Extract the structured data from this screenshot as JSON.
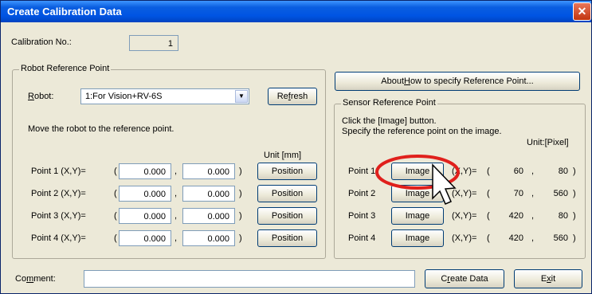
{
  "window": {
    "title": "Create Calibration Data",
    "close_glyph": "✕"
  },
  "calibration": {
    "label": "Calibration No.:",
    "value": "1"
  },
  "robot_group": {
    "title": "Robot Reference Point",
    "robot_label_u": "R",
    "robot_label_rest": "obot:",
    "robot_value": "1:For Vision+RV-6S",
    "refresh_pre": "Re",
    "refresh_u": "f",
    "refresh_post": "resh",
    "instruction": "Move the robot to the reference point.",
    "unit": "Unit [mm]",
    "paren_open": "(",
    "comma": ",",
    "paren_close": ")",
    "points": [
      {
        "label": "Point 1 (X,Y)=",
        "x": "0.000",
        "y": "0.000",
        "button": "Position"
      },
      {
        "label": "Point 2 (X,Y)=",
        "x": "0.000",
        "y": "0.000",
        "button": "Position"
      },
      {
        "label": "Point 3 (X,Y)=",
        "x": "0.000",
        "y": "0.000",
        "button": "Position"
      },
      {
        "label": "Point 4 (X,Y)=",
        "x": "0.000",
        "y": "0.000",
        "button": "Position"
      }
    ]
  },
  "about_button": {
    "pre": "About ",
    "u": "H",
    "post": "ow to specify Reference Point..."
  },
  "sensor_group": {
    "title": "Sensor Reference Point",
    "instruction_1": "Click the [Image] button.",
    "instruction_2": "Specify the reference point on the image.",
    "unit": "Unit:[Pixel]",
    "coord_label": "(X,Y)=",
    "paren_open": "(",
    "comma": ",",
    "paren_close": ")",
    "points": [
      {
        "label": "Point 1",
        "button": "Image",
        "x": "60",
        "y": "80"
      },
      {
        "label": "Point 2",
        "button": "Image",
        "x": "70",
        "y": "560"
      },
      {
        "label": "Point 3",
        "button": "Image",
        "x": "420",
        "y": "80"
      },
      {
        "label": "Point 4",
        "button": "Image",
        "x": "420",
        "y": "560"
      }
    ]
  },
  "comment": {
    "label_pre": "Co",
    "label_u": "m",
    "label_post": "ment:",
    "value": ""
  },
  "create_button": {
    "pre": "C",
    "u": "r",
    "post": "eate Data"
  },
  "exit_button": {
    "pre": "E",
    "u": "x",
    "post": "it"
  },
  "colors": {
    "highlight_ring": "#e0201c",
    "title_bar": "#0054e3"
  }
}
